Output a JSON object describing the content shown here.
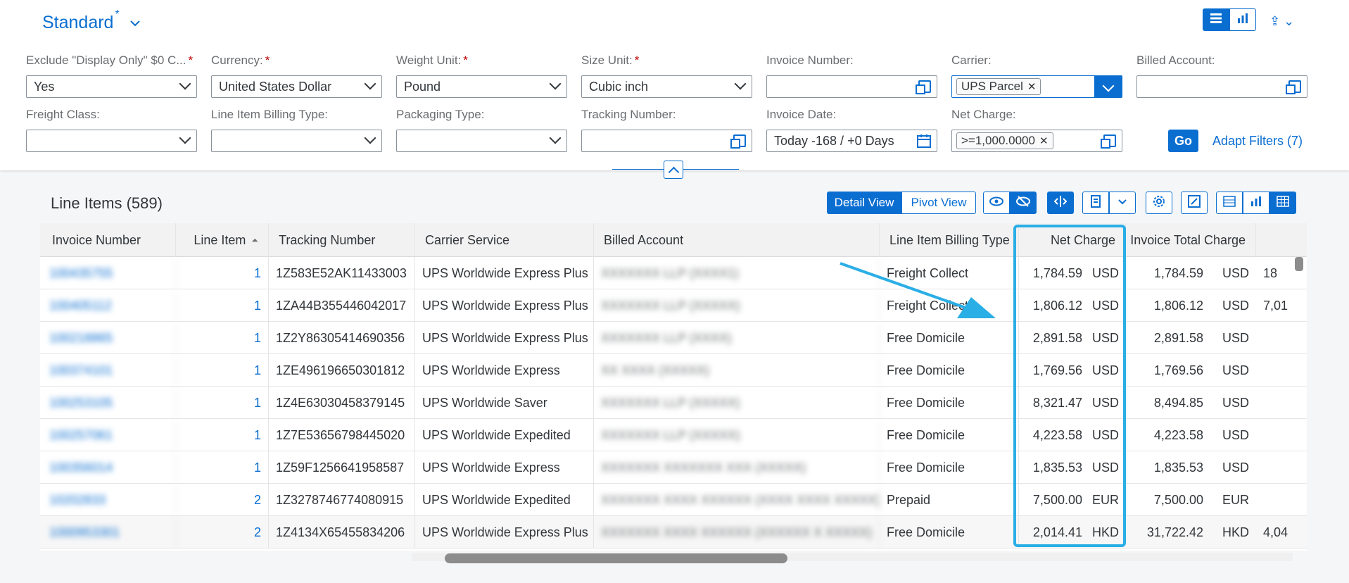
{
  "header": {
    "variant": "Standard",
    "star": "*",
    "chev": "⌄",
    "share": "⇪ ⌄"
  },
  "filters": {
    "exclude": {
      "label": "Exclude \"Display Only\" $0 C...",
      "req": "*",
      "value": "Yes"
    },
    "currency": {
      "label": "Currency:",
      "req": "*",
      "value": "United States Dollar"
    },
    "weight": {
      "label": "Weight Unit:",
      "req": "*",
      "value": "Pound"
    },
    "size": {
      "label": "Size Unit:",
      "req": "*",
      "value": "Cubic inch"
    },
    "invoice_number": {
      "label": "Invoice Number:"
    },
    "carrier": {
      "label": "Carrier:",
      "token": "UPS Parcel"
    },
    "billed_account": {
      "label": "Billed Account:"
    },
    "freight_class": {
      "label": "Freight Class:"
    },
    "billing_type": {
      "label": "Line Item Billing Type:"
    },
    "packaging": {
      "label": "Packaging Type:"
    },
    "tracking": {
      "label": "Tracking Number:"
    },
    "invoice_date": {
      "label": "Invoice Date:",
      "value": "Today -168 / +0 Days"
    },
    "net_charge": {
      "label": "Net Charge:",
      "token": ">=1,000.0000"
    },
    "token_x": "✕",
    "go": "Go",
    "adapt": "Adapt Filters (7)"
  },
  "table": {
    "title": "Line Items (589)",
    "views": {
      "detail": "Detail View",
      "pivot": "Pivot View"
    },
    "columns": [
      "Invoice Number",
      "Line Item",
      "Tracking Number",
      "Carrier Service",
      "Billed Account",
      "Line Item Billing Type",
      "Net Charge",
      "Invoice Total Charge"
    ],
    "sort_icon": "⏶",
    "rows": [
      {
        "inv": "100435755",
        "li": "1",
        "trk": "1Z583E52AK11433003",
        "svc": "UPS Worldwide Express Plus",
        "acct": "XXXXXXX LLP (XXXX1)",
        "type": "Freight Collect",
        "net": "1,784.59",
        "cur": "USD",
        "tot": "1,784.59",
        "tcur": "USD",
        "extra": "18"
      },
      {
        "inv": "100405112",
        "li": "1",
        "trk": "1ZA44B355446042017",
        "svc": "UPS Worldwide Express Plus",
        "acct": "XXXXXXX LLP (XXXXX)",
        "type": "Freight Collect",
        "net": "1,806.12",
        "cur": "USD",
        "tot": "1,806.12",
        "tcur": "USD",
        "extra": "7,01"
      },
      {
        "inv": "100218865",
        "li": "1",
        "trk": "1Z2Y86305414690356",
        "svc": "UPS Worldwide Express Plus",
        "acct": "XXXXXXX LLP (XXXX)",
        "type": "Free Domicile",
        "net": "2,891.58",
        "cur": "USD",
        "tot": "2,891.58",
        "tcur": "USD",
        "extra": ""
      },
      {
        "inv": "100374101",
        "li": "1",
        "trk": "1ZE496196650301812",
        "svc": "UPS Worldwide Express",
        "acct": "XX XXXX (XXXXX)",
        "type": "Free Domicile",
        "net": "1,769.56",
        "cur": "USD",
        "tot": "1,769.56",
        "tcur": "USD",
        "extra": ""
      },
      {
        "inv": "100253105",
        "li": "1",
        "trk": "1Z4E63030458379145",
        "svc": "UPS Worldwide Saver",
        "acct": "XXXXXXX LLP (XXXXX)",
        "type": "Free Domicile",
        "net": "8,321.47",
        "cur": "USD",
        "tot": "8,494.85",
        "tcur": "USD",
        "extra": ""
      },
      {
        "inv": "100257061",
        "li": "1",
        "trk": "1Z7E53656798445020",
        "svc": "UPS Worldwide Expedited",
        "acct": "XXXXXXX LLP (XXXXX)",
        "type": "Free Domicile",
        "net": "4,223.58",
        "cur": "USD",
        "tot": "4,223.58",
        "tcur": "USD",
        "extra": ""
      },
      {
        "inv": "100356014",
        "li": "1",
        "trk": "1Z59F1256641958587",
        "svc": "UPS Worldwide Express",
        "acct": "XXXXXXX XXXXXXX XXX (XXXXX)",
        "type": "Free Domicile",
        "net": "1,835.53",
        "cur": "USD",
        "tot": "1,835.53",
        "tcur": "USD",
        "extra": ""
      },
      {
        "inv": "10202833",
        "li": "2",
        "trk": "1Z3278746774080915",
        "svc": "UPS Worldwide Expedited",
        "acct": "XXXXXXX XXXX XXXXXX (XXXX XXXX XXXXX)",
        "type": "Prepaid",
        "net": "7,500.00",
        "cur": "EUR",
        "tot": "7,500.00",
        "tcur": "EUR",
        "extra": ""
      },
      {
        "inv": "1000953301",
        "li": "2",
        "trk": "1Z4134X65455834206",
        "svc": "UPS Worldwide Express Plus",
        "acct": "XXXXXXX XXXX XXXXXX (XXXXXX X XXXXX)",
        "type": "Free Domicile",
        "net": "2,014.41",
        "cur": "HKD",
        "tot": "31,722.42",
        "tcur": "HKD",
        "extra": "4,04"
      }
    ]
  },
  "colors": {
    "accent": "#0a6ed1",
    "highlight": "#2aaee6"
  }
}
